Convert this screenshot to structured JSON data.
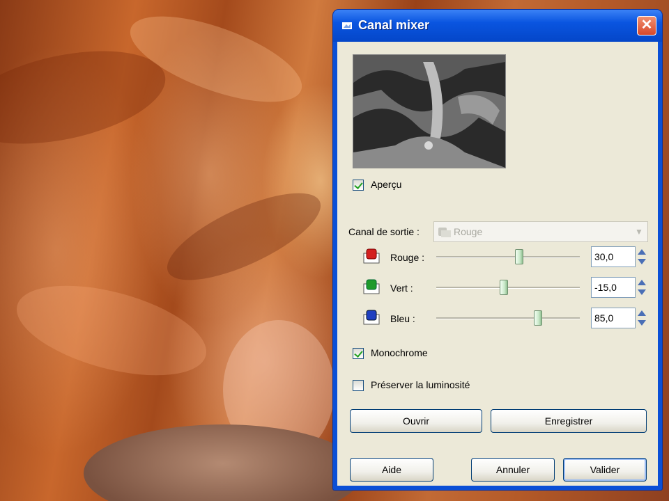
{
  "window": {
    "title": "Canal mixer",
    "close_symbol": "✕"
  },
  "options": {
    "preview_label": "Aperçu",
    "preview_checked": true,
    "output_channel_label": "Canal de sortie :",
    "output_channel_value": "Rouge",
    "monochrome_label": "Monochrome",
    "monochrome_checked": true,
    "preserve_label": "Préserver la luminosité",
    "preserve_checked": false
  },
  "channels": [
    {
      "name": "Rouge :",
      "value": "30,0",
      "icon": "red-channel-icon",
      "color": "#d42020",
      "level": 0.58
    },
    {
      "name": "Vert :",
      "value": "-15,0",
      "icon": "green-channel-icon",
      "color": "#1e9a2a",
      "level": 0.47
    },
    {
      "name": "Bleu :",
      "value": "85,0",
      "icon": "blue-channel-icon",
      "color": "#1f3fc0",
      "level": 0.71
    }
  ],
  "buttons": {
    "open": "Ouvrir",
    "save": "Enregistrer",
    "help": "Aide",
    "cancel": "Annuler",
    "ok": "Valider"
  },
  "colors": {
    "titlebar": "#0a55e0",
    "dialog_face": "#ece9d8",
    "close": "#d8482a"
  }
}
